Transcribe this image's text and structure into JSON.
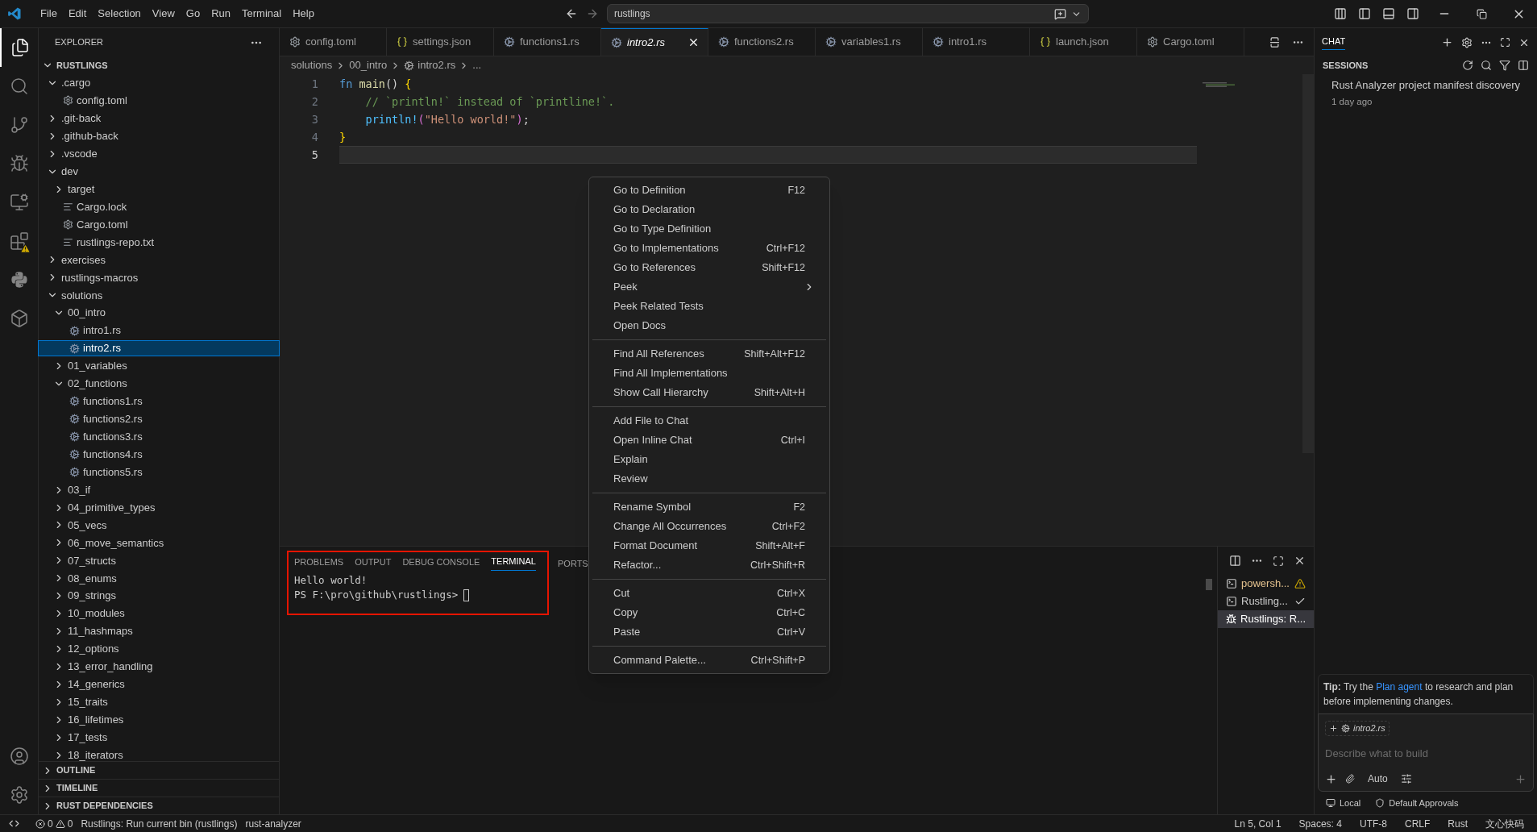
{
  "menu_bar": [
    "File",
    "Edit",
    "Selection",
    "View",
    "Go",
    "Run",
    "Terminal",
    "Help"
  ],
  "search": {
    "value": "rustlings"
  },
  "explorer": {
    "title": "EXPLORER",
    "root": "RUSTLINGS",
    "tree": [
      {
        "name": ".cargo",
        "kind": "folder",
        "expanded": true,
        "selected": false,
        "children": [
          {
            "name": "config.toml",
            "kind": "config",
            "selected": false
          }
        ]
      },
      {
        "name": ".git-back",
        "kind": "folder",
        "expanded": false,
        "selected": false
      },
      {
        "name": ".github-back",
        "kind": "folder",
        "expanded": false,
        "selected": false
      },
      {
        "name": ".vscode",
        "kind": "folder",
        "expanded": false,
        "selected": false
      },
      {
        "name": "dev",
        "kind": "folder",
        "expanded": true,
        "selected": false,
        "children": [
          {
            "name": "target",
            "kind": "folder",
            "expanded": false,
            "selected": false
          },
          {
            "name": "Cargo.lock",
            "kind": "text",
            "selected": false
          },
          {
            "name": "Cargo.toml",
            "kind": "config",
            "selected": false
          },
          {
            "name": "rustlings-repo.txt",
            "kind": "text",
            "selected": false
          }
        ]
      },
      {
        "name": "exercises",
        "kind": "folder",
        "expanded": false,
        "selected": false
      },
      {
        "name": "rustlings-macros",
        "kind": "folder",
        "expanded": false,
        "selected": false
      },
      {
        "name": "solutions",
        "kind": "folder",
        "expanded": true,
        "selected": false,
        "children": [
          {
            "name": "00_intro",
            "kind": "folder",
            "expanded": true,
            "selected": false,
            "children": [
              {
                "name": "intro1.rs",
                "kind": "rust",
                "selected": false
              },
              {
                "name": "intro2.rs",
                "kind": "rust",
                "selected": true
              }
            ]
          },
          {
            "name": "01_variables",
            "kind": "folder",
            "expanded": false,
            "selected": false
          },
          {
            "name": "02_functions",
            "kind": "folder",
            "expanded": true,
            "selected": false,
            "children": [
              {
                "name": "functions1.rs",
                "kind": "rust",
                "selected": false
              },
              {
                "name": "functions2.rs",
                "kind": "rust",
                "selected": false
              },
              {
                "name": "functions3.rs",
                "kind": "rust",
                "selected": false
              },
              {
                "name": "functions4.rs",
                "kind": "rust",
                "selected": false
              },
              {
                "name": "functions5.rs",
                "kind": "rust",
                "selected": false
              }
            ]
          },
          {
            "name": "03_if",
            "kind": "folder",
            "expanded": false,
            "selected": false
          },
          {
            "name": "04_primitive_types",
            "kind": "folder",
            "expanded": false,
            "selected": false
          },
          {
            "name": "05_vecs",
            "kind": "folder",
            "expanded": false,
            "selected": false
          },
          {
            "name": "06_move_semantics",
            "kind": "folder",
            "expanded": false,
            "selected": false
          },
          {
            "name": "07_structs",
            "kind": "folder",
            "expanded": false,
            "selected": false
          },
          {
            "name": "08_enums",
            "kind": "folder",
            "expanded": false,
            "selected": false
          },
          {
            "name": "09_strings",
            "kind": "folder",
            "expanded": false,
            "selected": false
          },
          {
            "name": "10_modules",
            "kind": "folder",
            "expanded": false,
            "selected": false
          },
          {
            "name": "11_hashmaps",
            "kind": "folder",
            "expanded": false,
            "selected": false
          },
          {
            "name": "12_options",
            "kind": "folder",
            "expanded": false,
            "selected": false
          },
          {
            "name": "13_error_handling",
            "kind": "folder",
            "expanded": false,
            "selected": false
          },
          {
            "name": "14_generics",
            "kind": "folder",
            "expanded": false,
            "selected": false
          },
          {
            "name": "15_traits",
            "kind": "folder",
            "expanded": false,
            "selected": false
          },
          {
            "name": "16_lifetimes",
            "kind": "folder",
            "expanded": false,
            "selected": false
          },
          {
            "name": "17_tests",
            "kind": "folder",
            "expanded": false,
            "selected": false
          },
          {
            "name": "18_iterators",
            "kind": "folder",
            "expanded": false,
            "selected": false
          }
        ]
      }
    ],
    "sections": [
      "OUTLINE",
      "TIMELINE",
      "RUST DEPENDENCIES"
    ]
  },
  "tabs": [
    {
      "label": "config.toml",
      "kind": "config",
      "selected": false
    },
    {
      "label": "settings.json",
      "kind": "json",
      "selected": false
    },
    {
      "label": "functions1.rs",
      "kind": "rust",
      "selected": false
    },
    {
      "label": "intro2.rs",
      "kind": "rust",
      "selected": true
    },
    {
      "label": "functions2.rs",
      "kind": "rust",
      "selected": false
    },
    {
      "label": "variables1.rs",
      "kind": "rust",
      "selected": false
    },
    {
      "label": "intro1.rs",
      "kind": "rust",
      "selected": false
    },
    {
      "label": "launch.json",
      "kind": "json",
      "selected": false
    },
    {
      "label": "Cargo.toml",
      "kind": "config",
      "selected": false
    }
  ],
  "breadcrumb": [
    "solutions",
    "00_intro",
    "intro2.rs",
    "..."
  ],
  "code": [
    {
      "number": "1",
      "current": false,
      "tokens": [
        {
          "text": "fn",
          "kind": "keyword"
        },
        {
          "text": " main",
          "kind": "function"
        },
        {
          "text": "()",
          "kind": "punct"
        },
        {
          "text": " {",
          "kind": "bracket"
        }
      ]
    },
    {
      "number": "2",
      "current": false,
      "tokens": [
        {
          "text": "    // `println!` instead of `printline!`.",
          "kind": "comment"
        }
      ]
    },
    {
      "number": "3",
      "current": false,
      "tokens": [
        {
          "text": "    println!",
          "kind": "macro"
        },
        {
          "text": "(",
          "kind": "bracket2"
        },
        {
          "text": "\"Hello world!\"",
          "kind": "string"
        },
        {
          "text": ")",
          "kind": "bracket2"
        },
        {
          "text": ";",
          "kind": "punct"
        }
      ]
    },
    {
      "number": "4",
      "current": false,
      "tokens": [
        {
          "text": "}",
          "kind": "bracket"
        }
      ]
    },
    {
      "number": "5",
      "current": true
    }
  ],
  "context_menu": [
    [
      {
        "label": "Go to Definition",
        "shortcut": "F12",
        "kind": "item"
      },
      {
        "label": "Go to Declaration",
        "kind": "item"
      },
      {
        "label": "Go to Type Definition",
        "kind": "item"
      },
      {
        "label": "Go to Implementations",
        "shortcut": "Ctrl+F12",
        "kind": "item"
      },
      {
        "label": "Go to References",
        "shortcut": "Shift+F12",
        "kind": "item"
      },
      {
        "label": "Peek",
        "kind": "submenu"
      },
      {
        "label": "Peek Related Tests",
        "kind": "item"
      },
      {
        "label": "Open Docs",
        "kind": "item"
      }
    ],
    [
      {
        "label": "Find All References",
        "shortcut": "Shift+Alt+F12",
        "kind": "item"
      },
      {
        "label": "Find All Implementations",
        "kind": "item"
      },
      {
        "label": "Show Call Hierarchy",
        "shortcut": "Shift+Alt+H",
        "kind": "item"
      }
    ],
    [
      {
        "label": "Add File to Chat",
        "kind": "item"
      },
      {
        "label": "Open Inline Chat",
        "shortcut": "Ctrl+I",
        "kind": "item"
      },
      {
        "label": "Explain",
        "kind": "item"
      },
      {
        "label": "Review",
        "kind": "item"
      }
    ],
    [
      {
        "label": "Rename Symbol",
        "shortcut": "F2",
        "kind": "item"
      },
      {
        "label": "Change All Occurrences",
        "shortcut": "Ctrl+F2",
        "kind": "item"
      },
      {
        "label": "Format Document",
        "shortcut": "Shift+Alt+F",
        "kind": "item"
      },
      {
        "label": "Refactor...",
        "shortcut": "Ctrl+Shift+R",
        "kind": "item"
      }
    ],
    [
      {
        "label": "Cut",
        "shortcut": "Ctrl+X",
        "kind": "item"
      },
      {
        "label": "Copy",
        "shortcut": "Ctrl+C",
        "kind": "item"
      },
      {
        "label": "Paste",
        "shortcut": "Ctrl+V",
        "kind": "item"
      }
    ],
    [
      {
        "label": "Command Palette...",
        "shortcut": "Ctrl+Shift+P",
        "kind": "item"
      }
    ]
  ],
  "panel": {
    "highlighted": true,
    "tabs": [
      {
        "label": "PROBLEMS",
        "selected": false
      },
      {
        "label": "OUTPUT",
        "selected": false
      },
      {
        "label": "DEBUG CONSOLE",
        "selected": false
      },
      {
        "label": "TERMINAL",
        "selected": true
      },
      {
        "label": "PORTS",
        "selected": false
      }
    ],
    "terminal_lines": [
      "Hello world!",
      "PS F:\\pro\\github\\rustlings>"
    ],
    "terminals": [
      {
        "label": "powersh...",
        "kind": "warning",
        "selected": false
      },
      {
        "label": "Rustling...",
        "kind": "done",
        "selected": false
      },
      {
        "label": "Rustlings: R...",
        "kind": "debug",
        "selected": true
      }
    ]
  },
  "chat": {
    "tab": "CHAT",
    "sessions_title": "SESSIONS",
    "sessions": [
      {
        "title": "Rust Analyzer project manifest discovery",
        "time": "1 day ago"
      }
    ],
    "tip": {
      "label": "Tip:",
      "before": "Try the",
      "link": "Plan agent",
      "after": "to research and plan before implementing changes."
    },
    "attachment": "intro2.rs",
    "placeholder": "Describe what to build",
    "mode": "Auto",
    "location": "Local",
    "approvals": "Default Approvals"
  },
  "status_bar": {
    "errors": "0",
    "warnings": "0",
    "task": "Rustlings: Run current bin (rustlings)",
    "server": "rust-analyzer",
    "right": [
      "Ln 5, Col 1",
      "Spaces: 4",
      "UTF-8",
      "CRLF",
      "Rust",
      "文心快码"
    ]
  }
}
